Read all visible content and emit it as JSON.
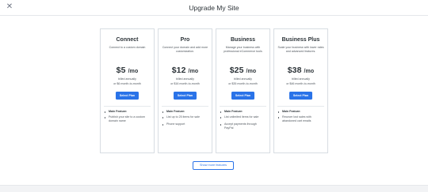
{
  "header": {
    "title": "Upgrade My Site",
    "close_icon": "close-icon"
  },
  "plans": [
    {
      "name": "Connect",
      "desc": "Connect to a custom domain",
      "price": "$5",
      "per": "/mo",
      "billed_1": "billed annually",
      "billed_2": "or $6 month-to-month",
      "button": "Select Plan",
      "features": [
        "Main Feature:",
        "Publish your site to a custom domain name"
      ]
    },
    {
      "name": "Pro",
      "desc": "Connect your domain and add more customization.",
      "price": "$12",
      "per": "/mo",
      "billed_1": "billed annually",
      "billed_2": "or $16 month-to-month",
      "button": "Select Plan",
      "features": [
        "Main Feature:",
        "List up to 25 items for sale",
        "Phone support"
      ]
    },
    {
      "name": "Business",
      "desc": "Manage your business with professional eCommerce tools",
      "price": "$25",
      "per": "/mo",
      "billed_1": "billed annually",
      "billed_2": "or $35 month-to-month",
      "button": "Select Plan",
      "features": [
        "Main Feature:",
        "List unlimited items for sale",
        "Accept payments through PayPal"
      ]
    },
    {
      "name": "Business Plus",
      "desc": "Scale your business with lower rates and advanced features.",
      "price": "$38",
      "per": "/mo",
      "billed_1": "billed annually",
      "billed_2": "or $46 month-to-month",
      "button": "Select Plan",
      "features": [
        "Main Feature:",
        "Recover lost sales with abandoned cart emails"
      ]
    }
  ],
  "show_more": "Show more features",
  "colors": {
    "accent": "#2a73e8",
    "border": "#d8dde2"
  }
}
